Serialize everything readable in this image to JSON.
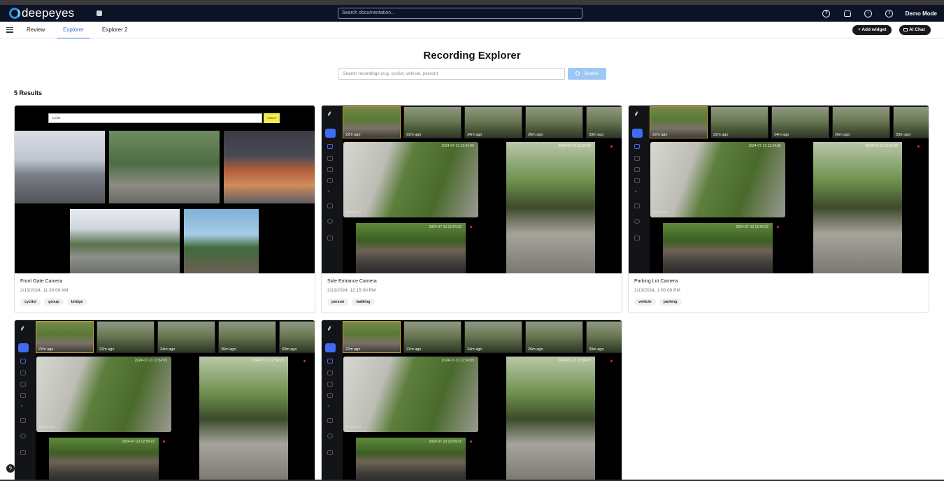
{
  "app": {
    "brand": "deepeyes",
    "mode": "Demo Mode"
  },
  "header": {
    "search_placeholder": "Search documentation..."
  },
  "tabs": [
    {
      "label": "Review",
      "active": false
    },
    {
      "label": "Explorer",
      "active": true
    },
    {
      "label": "Explorer 2",
      "active": false
    }
  ],
  "actions": {
    "add_widget": "+ Add widget",
    "ai_chat": "AI Chat"
  },
  "page": {
    "title": "Recording Explorer",
    "search_placeholder": "Search recordings (e.g. cyclist, vehicle, person)",
    "search_button": "Search",
    "results_label": "5 Results"
  },
  "cards": [
    {
      "camera": "Front Gate Camera",
      "timestamp": "2/13/2024, 11:30:00 AM",
      "tags": [
        "cyclist",
        "group",
        "bridge"
      ],
      "query": "cyclist",
      "query_button": "Search"
    },
    {
      "camera": "Side Entrance Camera",
      "timestamp": "2/13/2024, 12:15:00 PM",
      "tags": [
        "person",
        "walking"
      ]
    },
    {
      "camera": "Parking Lot Camera",
      "timestamp": "2/13/2024, 1:00:00 PM",
      "tags": [
        "vehicle",
        "parking"
      ]
    },
    {
      "camera": "",
      "timestamp": "",
      "tags": []
    },
    {
      "camera": "",
      "timestamp": "",
      "tags": []
    }
  ],
  "feed": {
    "strip_labels": [
      "22m ago",
      "22m ago",
      "24m ago",
      "26m ago",
      "33m ago"
    ],
    "timestamp": "2024-07-13 12:54:05",
    "timestamp2": "2024-07-13 12:54:22",
    "timestamp3": "2024-07-13 12:54:22",
    "camera_label": "Backyard"
  }
}
